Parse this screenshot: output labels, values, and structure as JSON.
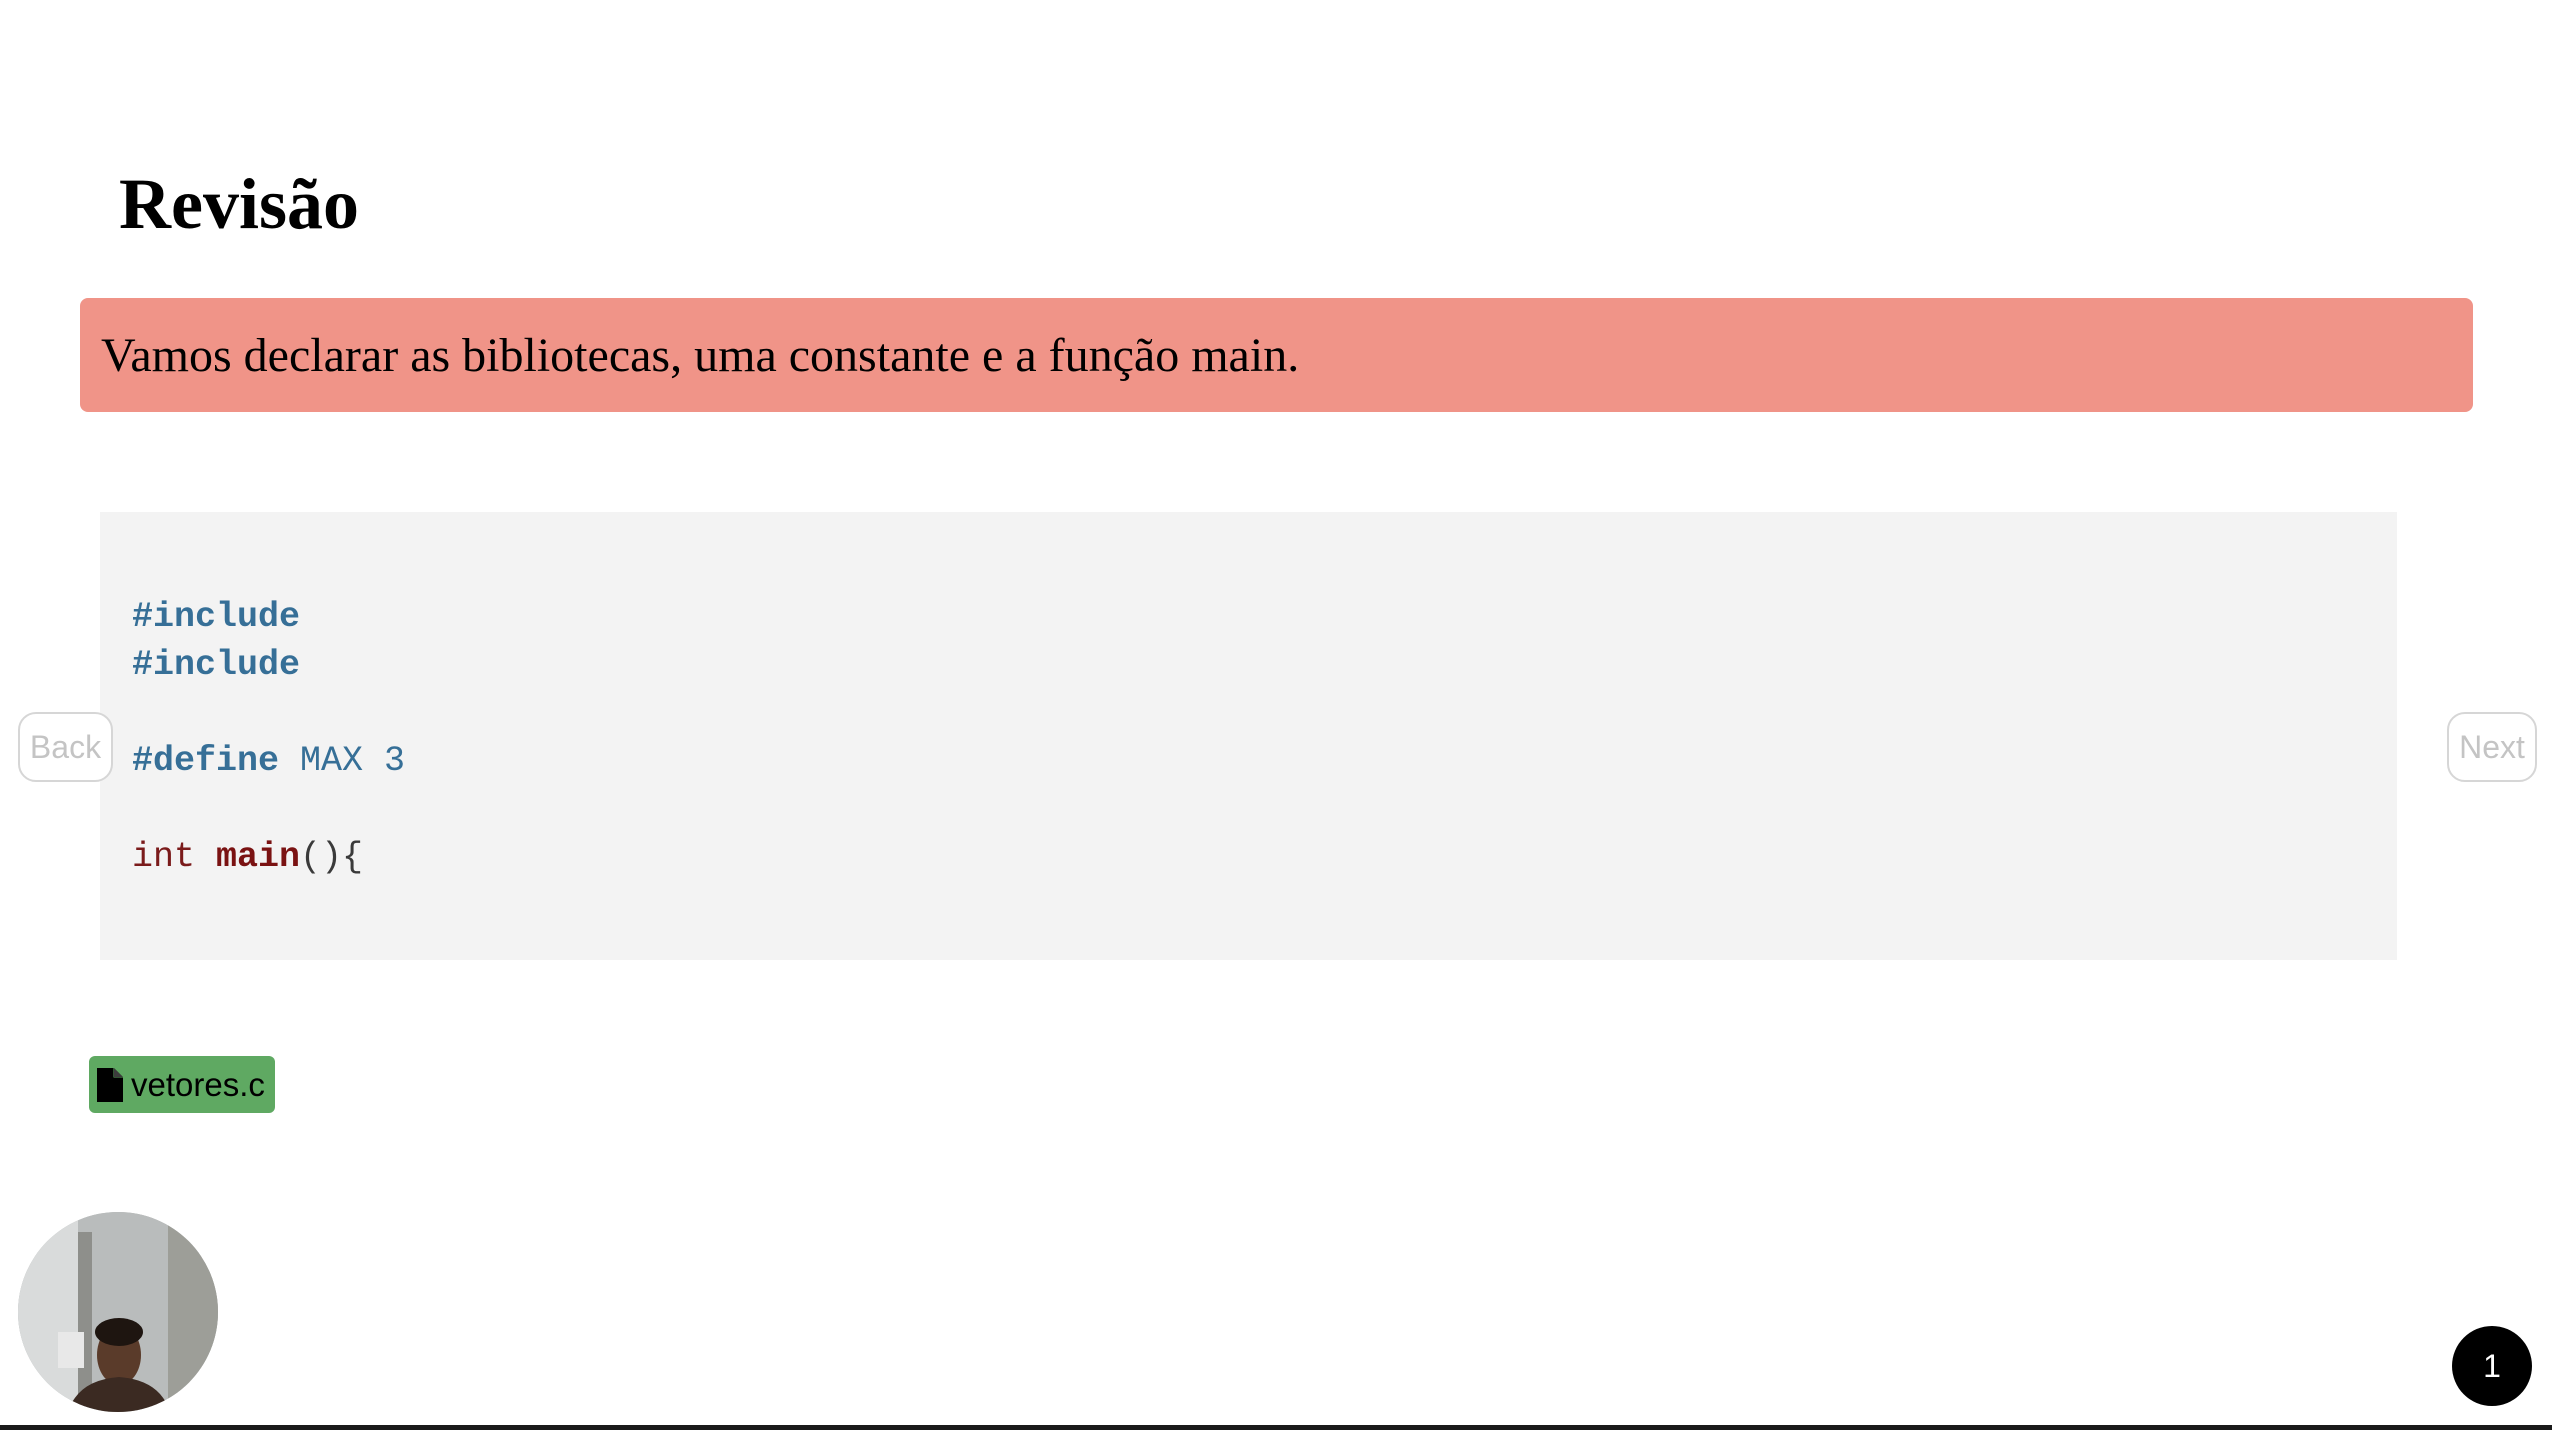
{
  "slide": {
    "title": "Revisão",
    "banner_text": "Vamos declarar as bibliotecas, uma constante e a função main.",
    "page_number": "1"
  },
  "code": {
    "line1_directive": "#include",
    "line2_directive": "#include",
    "line4_directive": "#define",
    "line4_macro": "MAX 3",
    "line6_type": "int",
    "line6_function": "main",
    "line6_punct": "(){"
  },
  "nav": {
    "back_label": "Back",
    "next_label": "Next"
  },
  "attachment": {
    "filename": "vetores.c",
    "icon": "file-icon"
  },
  "presenter": {
    "icon": "webcam-avatar"
  },
  "colors": {
    "banner_bg": "#f09488",
    "code_bg": "#f3f3f3",
    "directive": "#366f97",
    "keyword_fn": "#7a1212",
    "file_chip_bg": "#5fa962",
    "nav_border": "#d6d6d6"
  }
}
